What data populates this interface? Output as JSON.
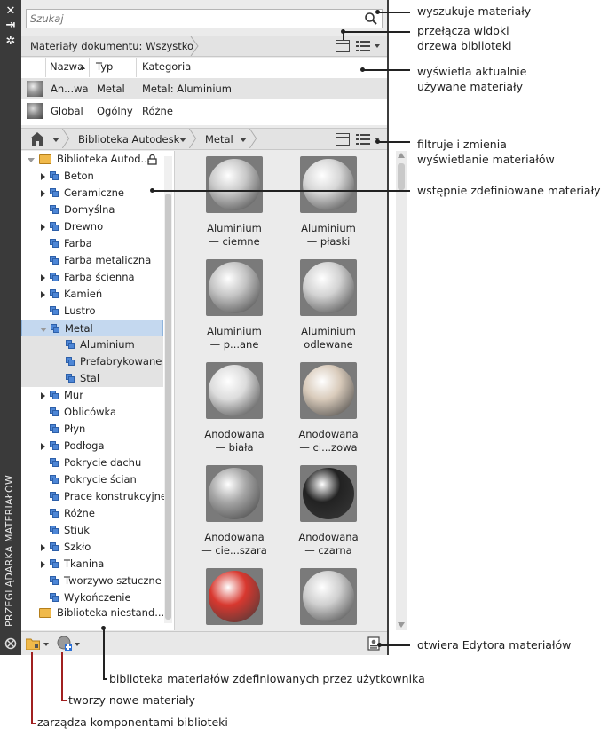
{
  "palette": {
    "vertical_title": "PRZEGLĄDARKA MATERIAŁÓW",
    "close_glyph": "✕",
    "autohide_glyph": "⇥",
    "settings_glyph": "✲"
  },
  "search": {
    "placeholder": "Szukaj"
  },
  "document_bar": {
    "filter_label": "Materiały dokumentu: Wszystko"
  },
  "document_table": {
    "headers": [
      "Nazwa",
      "Typ",
      "Kategoria"
    ],
    "rows": [
      {
        "name": "An...wa",
        "type": "Metal",
        "category": "Metal: Aluminium"
      },
      {
        "name": "Global",
        "type": "Ogólny",
        "category": "Różne"
      }
    ]
  },
  "library_bar": {
    "crumbs": [
      "Biblioteka Autodesk",
      "Metal"
    ]
  },
  "tree": {
    "root": "Biblioteka Autod...",
    "items": [
      {
        "label": "Beton",
        "expandable": true
      },
      {
        "label": "Ceramiczne",
        "expandable": true
      },
      {
        "label": "Domyślna",
        "expandable": false
      },
      {
        "label": "Drewno",
        "expandable": true
      },
      {
        "label": "Farba",
        "expandable": false
      },
      {
        "label": "Farba metaliczna",
        "expandable": false
      },
      {
        "label": "Farba ścienna",
        "expandable": true
      },
      {
        "label": "Kamień",
        "expandable": true
      },
      {
        "label": "Lustro",
        "expandable": false
      },
      {
        "label": "Metal",
        "expandable": true,
        "selected": true
      },
      {
        "label": "Aluminium",
        "child": true
      },
      {
        "label": "Prefabrykowane",
        "child": true
      },
      {
        "label": "Stal",
        "child": true
      },
      {
        "label": "Mur",
        "expandable": true
      },
      {
        "label": "Oblicówka",
        "expandable": false
      },
      {
        "label": "Płyn",
        "expandable": false
      },
      {
        "label": "Podłoga",
        "expandable": true
      },
      {
        "label": "Pokrycie dachu",
        "expandable": false
      },
      {
        "label": "Pokrycie ścian",
        "expandable": false
      },
      {
        "label": "Prace konstrukcyjne",
        "expandable": false
      },
      {
        "label": "Różne",
        "expandable": false
      },
      {
        "label": "Stiuk",
        "expandable": false
      },
      {
        "label": "Szkło",
        "expandable": true
      },
      {
        "label": "Tkanina",
        "expandable": true
      },
      {
        "label": "Tworzywo sztuczne",
        "expandable": false
      },
      {
        "label": "Wykończenie",
        "expandable": false
      }
    ],
    "user_library": "Biblioteka niestand..."
  },
  "materials": [
    {
      "line1": "Aluminium",
      "line2": "— ciemne",
      "color": "#c8c8c8"
    },
    {
      "line1": "Aluminium",
      "line2": "— płaski",
      "color": "#d6d6d6"
    },
    {
      "line1": "Aluminium",
      "line2": "— p...ane",
      "color": "#c4c4c4"
    },
    {
      "line1": "Aluminium",
      "line2": "odlewane",
      "color": "#d2d2d2"
    },
    {
      "line1": "Anodowana",
      "line2": "— biała",
      "color": "#dcdcdc"
    },
    {
      "line1": "Anodowana",
      "line2": "— ci...zowa",
      "color": "#d9cbbb"
    },
    {
      "line1": "Anodowana",
      "line2": "— cie...szara",
      "color": "#a6a6a6"
    },
    {
      "line1": "Anodowana",
      "line2": "— czarna",
      "color": "#222222"
    },
    {
      "line1": "",
      "line2": "",
      "color": "#d8382f"
    },
    {
      "line1": "",
      "line2": "",
      "color": "#cfcfcf"
    }
  ],
  "callouts": {
    "search": "wyszukuje materiały",
    "toggle_views": [
      "przełącza widoki",
      "drzewa biblioteki"
    ],
    "current_materials": [
      "wyświetla aktualnie",
      "używane materiały"
    ],
    "filter": [
      "filtruje i zmienia",
      "wyświetlanie materiałów"
    ],
    "predefined": "wstępnie zdefiniowane materiały",
    "open_editor": "otwiera Edytora materiałów",
    "user_library": "biblioteka materiałów zdefiniowanych przez użytkownika",
    "create_new": "tworzy nowe materiały",
    "manage_components": "zarządza komponentami biblioteki"
  }
}
